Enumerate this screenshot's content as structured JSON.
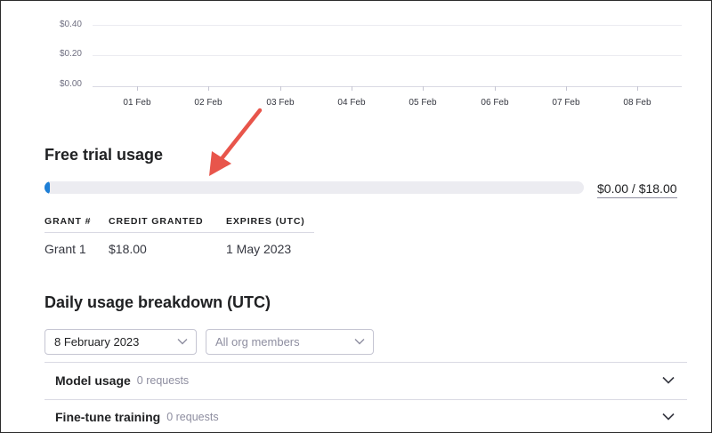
{
  "chart": {
    "y_ticks": [
      "$0.40",
      "$0.20",
      "$0.00"
    ],
    "x_ticks": [
      "01 Feb",
      "02 Feb",
      "03 Feb",
      "04 Feb",
      "05 Feb",
      "06 Feb",
      "07 Feb",
      "08 Feb"
    ]
  },
  "free_trial": {
    "title": "Free trial usage",
    "amount": "$0.00 / $18.00",
    "progress_fraction": 0,
    "accent_color": "#1e7fd6",
    "columns": [
      "GRANT #",
      "CREDIT GRANTED",
      "EXPIRES (UTC)"
    ],
    "rows": [
      {
        "grant": "Grant 1",
        "credit": "$18.00",
        "expires": "1 May 2023"
      }
    ]
  },
  "daily": {
    "title": "Daily usage breakdown (UTC)",
    "date_select": "8 February 2023",
    "members_select": "All org members",
    "sections": [
      {
        "title": "Model usage",
        "sub": "0 requests",
        "icon": "chevron-down-icon"
      },
      {
        "title": "Fine-tune training",
        "sub": "0 requests",
        "icon": "chevron-down-icon"
      }
    ]
  },
  "annotation": {
    "color": "#e8554b",
    "icon": "red-arrow-annotation"
  }
}
